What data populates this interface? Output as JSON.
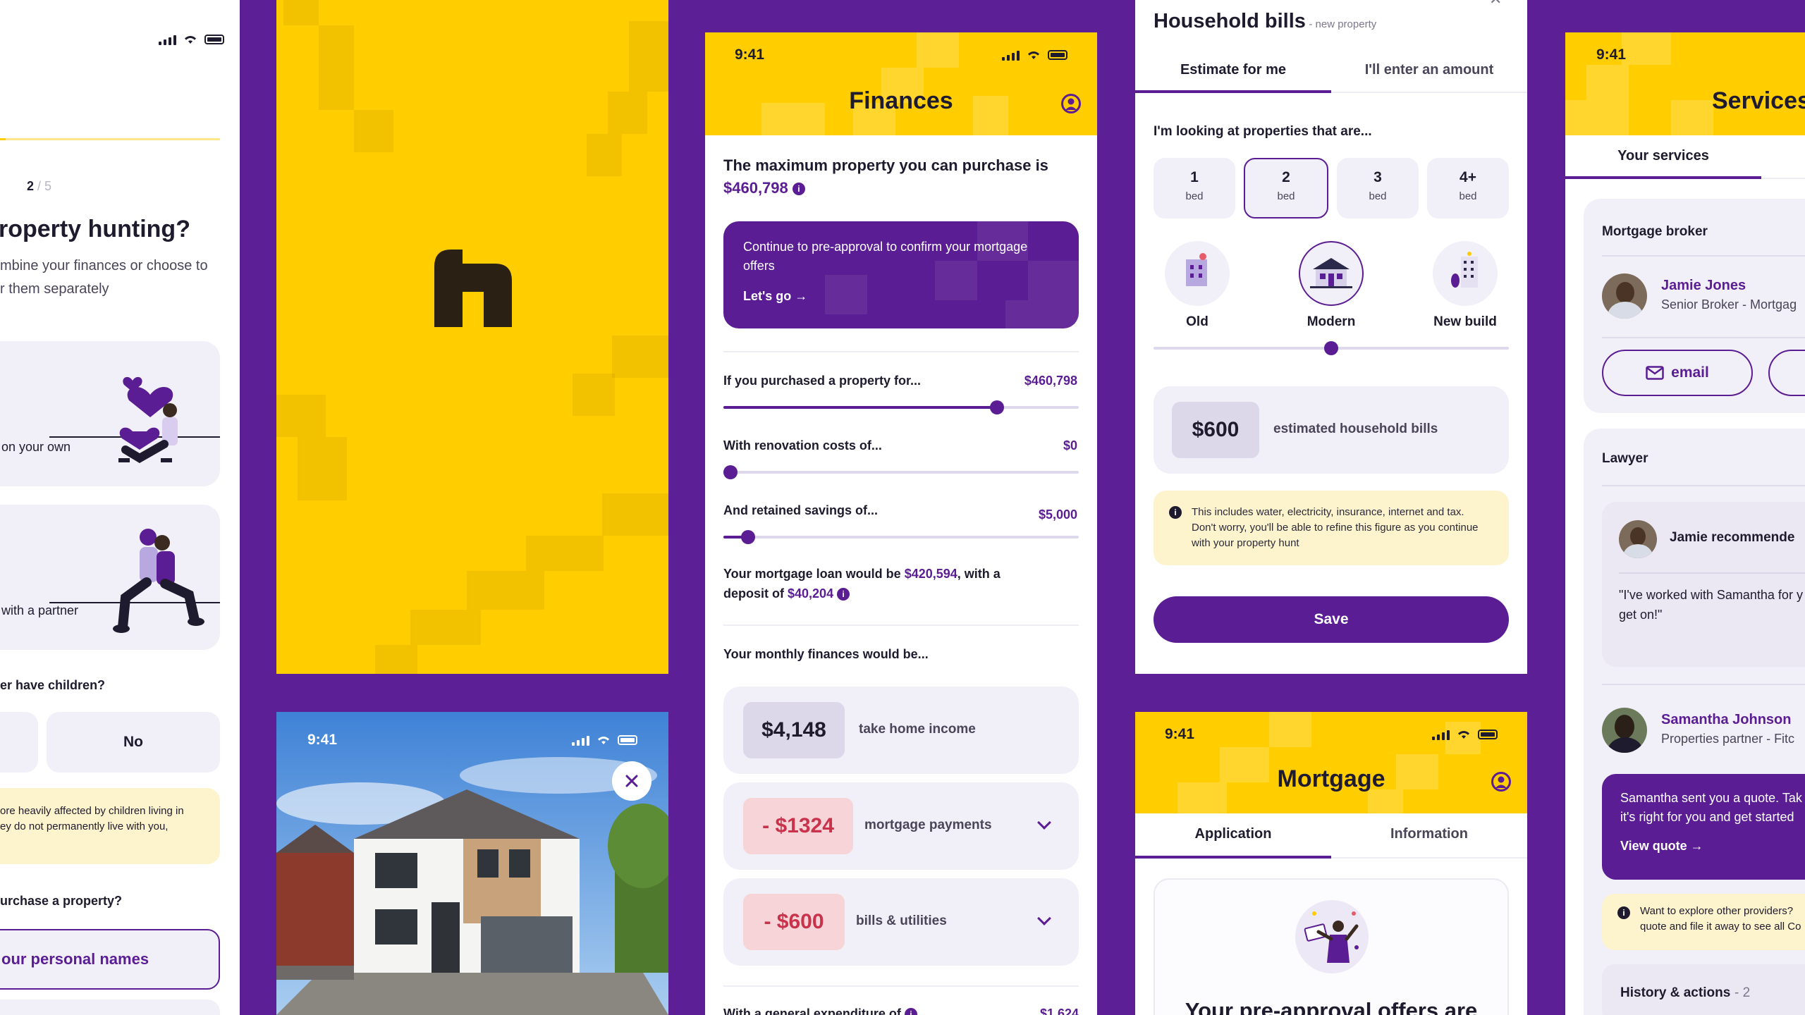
{
  "panel1": {
    "step_current": "2",
    "step_total": "/ 5",
    "title": "roperty hunting?",
    "subtitle_l1": "mbine your finances or choose to",
    "subtitle_l2": "r them separately",
    "option_own": "on your own",
    "option_partner": "with a partner",
    "children_q": "er have children?",
    "no_label": "No",
    "note_l1": "ore heavily affected by children living in",
    "note_l2": "ey do not permanently live with you,",
    "purchase_q": "urchase a property?",
    "names_option": "our personal names"
  },
  "photo_panel": {
    "time": "9:41"
  },
  "finances": {
    "time": "9:41",
    "title": "Finances",
    "max_text": "The maximum property you can purchase is",
    "max_value": "$460,798",
    "banner_text_l1": "Continue to pre-approval to confirm your mortgage",
    "banner_text_l2": "offers",
    "banner_cta": "Let's go →",
    "slider1_label": "If you purchased a property for...",
    "slider1_value": "$460,798",
    "slider1_level": 0.77,
    "slider2_label": "With renovation costs of...",
    "slider2_value": "$0",
    "slider2_level": 0.02,
    "slider3_label": "And retained savings of...",
    "slider3_value": "$5,000",
    "slider3_level": 0.07,
    "loan_prefix": "Your mortgage loan would be",
    "loan_value": "$420,594",
    "loan_mid": ", with a",
    "deposit_prefix": "deposit of",
    "deposit_value": "$40,204",
    "monthly_heading": "Your monthly finances would be...",
    "income_value": "$4,148",
    "income_label": "take home income",
    "mortgage_value": "- $1324",
    "mortgage_label": "mortgage payments",
    "bills_value": "- $600",
    "bills_label": "bills & utilities",
    "bottom_text": "With a general expenditure of",
    "bottom_value": "$1,624"
  },
  "household": {
    "title": "Household bills",
    "title_note": "- new property",
    "tab_estimate": "Estimate for me",
    "tab_enter": "I'll enter an amount",
    "looking_label": "I'm looking at properties that are...",
    "beds": [
      {
        "num": "1",
        "unit": "bed"
      },
      {
        "num": "2",
        "unit": "bed"
      },
      {
        "num": "3",
        "unit": "bed"
      },
      {
        "num": "4+",
        "unit": "bed"
      }
    ],
    "types": [
      "Old",
      "Modern",
      "New build"
    ],
    "type_level": 0.5,
    "estimate_value": "$600",
    "estimate_label": "estimated household bills",
    "info_l1": "This includes water, electricity, insurance, internet and tax.",
    "info_l2": "Don't worry, you'll be able to refine this figure as you continue",
    "info_l3": "with your property hunt",
    "save_label": "Save"
  },
  "mortgage": {
    "time": "9:41",
    "title": "Mortgage",
    "tab_application": "Application",
    "tab_information": "Information",
    "preapproval": "Your pre-approval offers are"
  },
  "services": {
    "time": "9:41",
    "title": "Services",
    "tab": "Your services",
    "broker_heading": "Mortgage broker",
    "broker_name": "Jamie Jones",
    "broker_role": "Senior Broker - Mortgag",
    "email_label": "email",
    "lawyer_heading": "Lawyer",
    "recommend_text": "Jamie recommende",
    "quote_l1": "\"I've worked with Samantha for y",
    "quote_l2": "get on!\"",
    "lawyer_name": "Samantha Johnson",
    "lawyer_role": "Properties partner - Fitc",
    "quote_banner_l1": "Samantha sent you a quote. Tak",
    "quote_banner_l2": "it's right for you and get started",
    "view_quote": "View quote →",
    "explore_l1": "Want to explore other providers?",
    "explore_l2": "quote and file it away to see all Co",
    "history": "History & actions",
    "history_count": "- 2"
  },
  "colors": {
    "brand_purple": "#5c1f96",
    "brand_yellow": "#ffcd00",
    "negative_bg": "#f6d4d8",
    "negative_text": "#c8324a"
  }
}
